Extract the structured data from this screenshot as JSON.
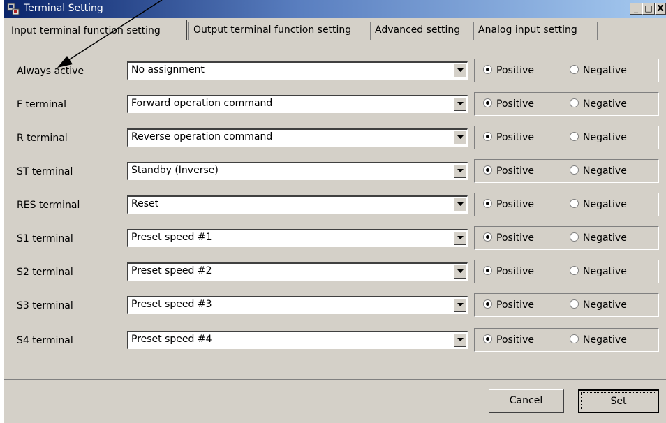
{
  "window": {
    "title": "Terminal Setting",
    "controls": {
      "minimize": "_",
      "maximize": "□",
      "close": "X"
    }
  },
  "tabs": [
    {
      "label": "Input terminal function setting",
      "active": true
    },
    {
      "label": "Output terminal function setting",
      "active": false
    },
    {
      "label": "Advanced setting",
      "active": false
    },
    {
      "label": "Analog input setting",
      "active": false
    }
  ],
  "rows": [
    {
      "label": "Always active",
      "value": "No assignment",
      "logic": "Positive"
    },
    {
      "label": "F terminal",
      "value": "Forward operation command",
      "logic": "Positive"
    },
    {
      "label": "R terminal",
      "value": "Reverse operation command",
      "logic": "Positive"
    },
    {
      "label": "ST terminal",
      "value": "Standby (Inverse)",
      "logic": "Positive"
    },
    {
      "label": "RES terminal",
      "value": "Reset",
      "logic": "Positive"
    },
    {
      "label": "S1 terminal",
      "value": "Preset speed #1",
      "logic": "Positive"
    },
    {
      "label": "S2 terminal",
      "value": "Preset speed #2",
      "logic": "Positive"
    },
    {
      "label": "S3 terminal",
      "value": "Preset speed #3",
      "logic": "Positive"
    },
    {
      "label": "S4 terminal",
      "value": "Preset speed #4",
      "logic": "Positive"
    }
  ],
  "radio_labels": {
    "positive": "Positive",
    "negative": "Negative"
  },
  "buttons": {
    "cancel": "Cancel",
    "set": "Set"
  },
  "colors": {
    "face": "#d4d0c8",
    "title_start": "#0a246a",
    "title_end": "#a6caf0"
  }
}
